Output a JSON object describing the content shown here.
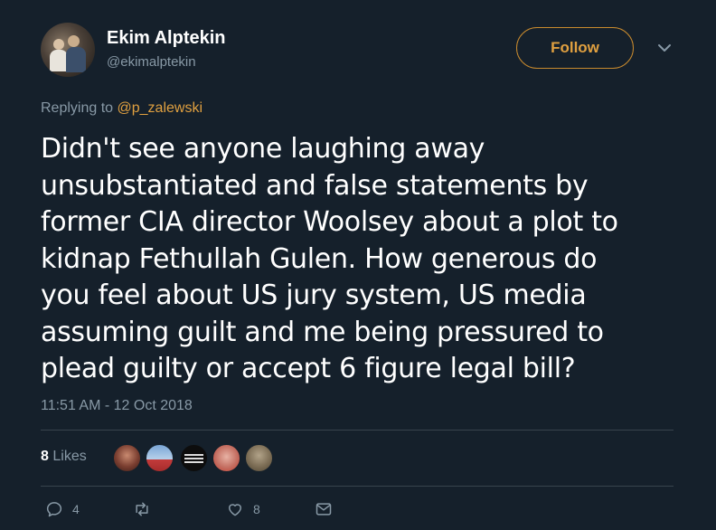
{
  "author": {
    "display_name": "Ekim Alptekin",
    "handle": "@ekimalptekin",
    "avatar_icon": "profile-photo"
  },
  "header": {
    "follow_label": "Follow",
    "accent_color": "#e0a040"
  },
  "reply": {
    "prefix": "Replying to",
    "mention": "@p_zalewski"
  },
  "tweet": {
    "text": "Didn't see anyone laughing away\nunsubstantiated and false statements by\nformer CIA director Woolsey about a plot to\nkidnap Fethullah Gulen. How generous do\nyou feel about US jury system, US media\nassuming guilt and me being pressured to\nplead guilty or accept 6 figure legal bill?",
    "timestamp": "11:51 AM - 12 Oct 2018"
  },
  "stats": {
    "likes_count": "8",
    "likes_label": "Likes"
  },
  "actions": {
    "reply_count": "4",
    "retweet_count": "",
    "like_count": "8"
  },
  "colors": {
    "background": "#15202b",
    "secondary_text": "#8899a6",
    "divider": "#38444d"
  }
}
